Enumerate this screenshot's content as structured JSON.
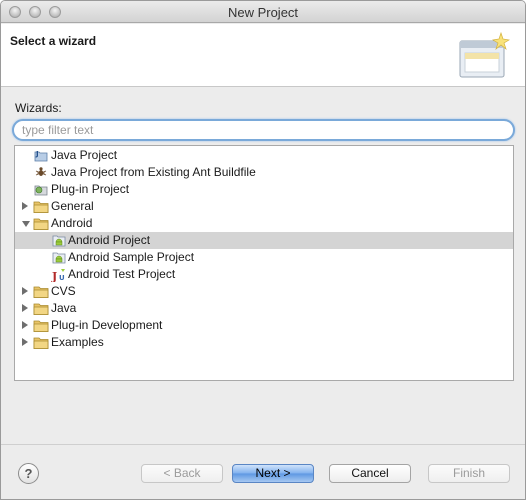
{
  "window": {
    "title": "New Project"
  },
  "header": {
    "title": "Select a wizard",
    "graphic_icon": "wizard-banner-icon"
  },
  "wizards": {
    "label": "Wizards:",
    "filter_placeholder": "type filter text",
    "filter_value": ""
  },
  "tree": {
    "items": [
      {
        "label": "Java Project",
        "icon": "java-project-icon",
        "level": 0,
        "twisty": "none",
        "selected": false
      },
      {
        "label": "Java Project from Existing Ant Buildfile",
        "icon": "ant-icon",
        "level": 0,
        "twisty": "none",
        "selected": false
      },
      {
        "label": "Plug-in Project",
        "icon": "plugin-project-icon",
        "level": 0,
        "twisty": "none",
        "selected": false
      },
      {
        "label": "General",
        "icon": "folder-icon",
        "level": 0,
        "twisty": "closed",
        "selected": false
      },
      {
        "label": "Android",
        "icon": "folder-icon",
        "level": 0,
        "twisty": "open",
        "selected": false
      },
      {
        "label": "Android Project",
        "icon": "android-project-icon",
        "level": 1,
        "twisty": "none",
        "selected": true
      },
      {
        "label": "Android Sample Project",
        "icon": "android-project-icon",
        "level": 1,
        "twisty": "none",
        "selected": false
      },
      {
        "label": "Android Test Project",
        "icon": "junit-icon",
        "level": 1,
        "twisty": "none",
        "selected": false
      },
      {
        "label": "CVS",
        "icon": "folder-icon",
        "level": 0,
        "twisty": "closed",
        "selected": false
      },
      {
        "label": "Java",
        "icon": "folder-icon",
        "level": 0,
        "twisty": "closed",
        "selected": false
      },
      {
        "label": "Plug-in Development",
        "icon": "folder-icon",
        "level": 0,
        "twisty": "closed",
        "selected": false
      },
      {
        "label": "Examples",
        "icon": "folder-icon",
        "level": 0,
        "twisty": "closed",
        "selected": false
      }
    ]
  },
  "buttons": {
    "help": "?",
    "back": "< Back",
    "next": "Next >",
    "cancel": "Cancel",
    "finish": "Finish"
  },
  "colors": {
    "selection": "#d4d4d4",
    "focus_ring": "#7aa9d9",
    "folder": "#e8c468",
    "primary_button": "#5d97e2"
  }
}
